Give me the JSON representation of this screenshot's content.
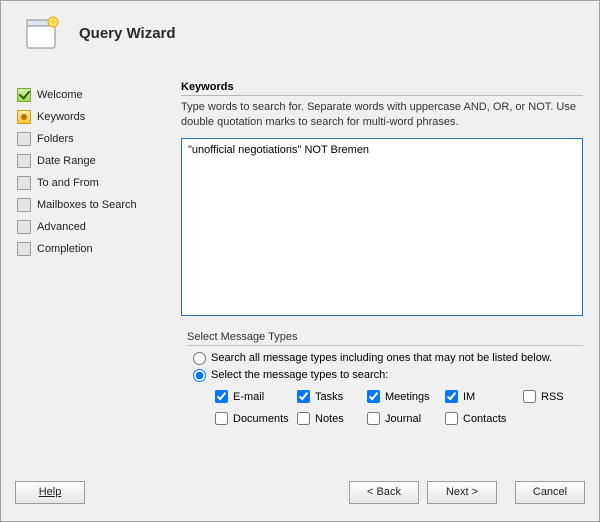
{
  "header": {
    "title": "Query Wizard"
  },
  "sidebar": {
    "items": [
      {
        "label": "Welcome",
        "state": "done"
      },
      {
        "label": "Keywords",
        "state": "active"
      },
      {
        "label": "Folders",
        "state": "pending"
      },
      {
        "label": "Date Range",
        "state": "pending"
      },
      {
        "label": "To and From",
        "state": "pending"
      },
      {
        "label": "Mailboxes to Search",
        "state": "pending"
      },
      {
        "label": "Advanced",
        "state": "pending"
      },
      {
        "label": "Completion",
        "state": "pending"
      }
    ]
  },
  "main": {
    "section_title": "Keywords",
    "section_desc": "Type words to search for. Separate words with uppercase AND, OR, or NOT. Use double quotation marks to search for multi-word phrases.",
    "keyword_value": "\"unofficial negotiations\" NOT Bremen",
    "msg_legend": "Select Message Types",
    "radio_all": "Search all message types including ones that may not be listed below.",
    "radio_select": "Select the message types to search:",
    "radio_choice": "select",
    "types": {
      "email": {
        "label": "E-mail",
        "checked": true
      },
      "tasks": {
        "label": "Tasks",
        "checked": true
      },
      "meetings": {
        "label": "Meetings",
        "checked": true
      },
      "im": {
        "label": "IM",
        "checked": true
      },
      "rss": {
        "label": "RSS",
        "checked": false
      },
      "documents": {
        "label": "Documents",
        "checked": false
      },
      "notes": {
        "label": "Notes",
        "checked": false
      },
      "journal": {
        "label": "Journal",
        "checked": false
      },
      "contacts": {
        "label": "Contacts",
        "checked": false
      }
    }
  },
  "footer": {
    "help": "Help",
    "back": "< Back",
    "next": "Next >",
    "cancel": "Cancel"
  }
}
